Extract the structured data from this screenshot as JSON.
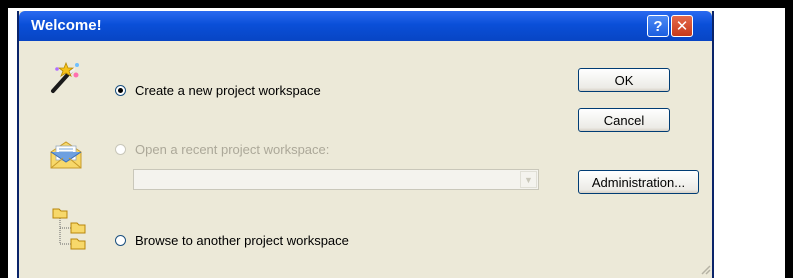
{
  "dialog": {
    "title": "Welcome!",
    "help_glyph": "?",
    "close_glyph": "✕"
  },
  "options": [
    {
      "label": "Create a new project workspace",
      "selected": true,
      "enabled": true,
      "icon": "wizard-wand-icon"
    },
    {
      "label": "Open a recent project workspace:",
      "selected": false,
      "enabled": false,
      "icon": "open-envelope-icon"
    },
    {
      "label": "Browse to another project workspace",
      "selected": false,
      "enabled": true,
      "icon": "folder-tree-icon"
    }
  ],
  "recent_combo": {
    "value": "",
    "arrow_glyph": "▼"
  },
  "buttons": {
    "ok": "OK",
    "cancel": "Cancel",
    "administration": "Administration..."
  },
  "colors": {
    "titlebar": "#0a4fd8",
    "dialog_bg": "#ece9d8",
    "close": "#c6391a"
  }
}
